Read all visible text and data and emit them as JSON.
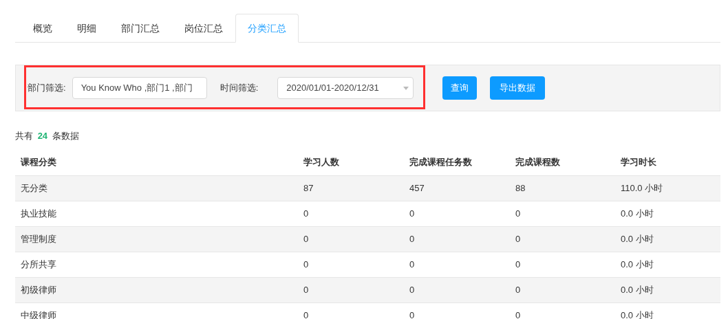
{
  "tabs": [
    {
      "label": "概览",
      "selected": false
    },
    {
      "label": "明细",
      "selected": false
    },
    {
      "label": "部门汇总",
      "selected": false
    },
    {
      "label": "岗位汇总",
      "selected": false
    },
    {
      "label": "分类汇总",
      "selected": true
    }
  ],
  "filters": {
    "department_label": "部门筛选:",
    "department_value": "You Know Who ,部门1 ,部门",
    "time_label": "时间筛选:",
    "time_value": "2020/01/01-2020/12/31",
    "highlighted": true
  },
  "buttons": [
    "查询",
    "导出数据"
  ],
  "summary": {
    "prefix": "共有",
    "count": "24",
    "suffix": "条数据"
  },
  "table": {
    "columns": [
      "课程分类",
      "学习人数",
      "完成课程任务数",
      "完成课程数",
      "学习时长"
    ],
    "rows": [
      [
        "无分类",
        "87",
        "457",
        "88",
        "110.0 小时"
      ],
      [
        "执业技能",
        "0",
        "0",
        "0",
        "0.0 小时"
      ],
      [
        "管理制度",
        "0",
        "0",
        "0",
        "0.0 小时"
      ],
      [
        "分所共享",
        "0",
        "0",
        "0",
        "0.0 小时"
      ],
      [
        "初级律师",
        "0",
        "0",
        "0",
        "0.0 小时"
      ],
      [
        "中级律师",
        "0",
        "0",
        "0",
        "0.0 小时"
      ]
    ]
  }
}
